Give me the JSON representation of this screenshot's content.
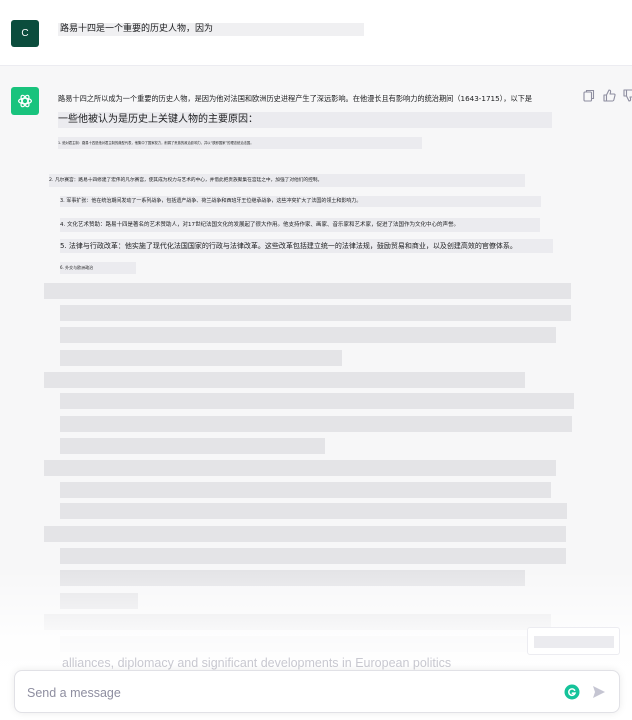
{
  "user": {
    "avatar_letter": "C",
    "prompt": "路易十四是一个重要的历史人物，因为"
  },
  "assistant": {
    "p1": "路易十四之所以成为一个重要的历史人物，是因为他对法国和欧洲历史进程产生了深远影响。在他漫长且有影响力的统治期间（1643-1715），以下是",
    "p2": "一些他被认为是历史上关键人物的主要原因：",
    "l1": "1. 绝对君主制：路易十四是绝对君主制的典型代表，他集中了国家权力，削弱了贵族的政治影响力，并以“朕即国家”的理念统治法国。",
    "l2": "2. 凡尔赛宫：路易十四修建了宏伟的凡尔赛宫，使其成为权力与艺术的中心，并借此把贵族聚集在宫廷之中，加强了对他们的控制。",
    "l3": "3. 军事扩张：他在统治期间发动了一系列战争，包括遗产战争、荷兰战争和西班牙王位继承战争，这些冲突扩大了法国的领土和影响力。",
    "l4": "4. 文化艺术赞助：路易十四是著名的艺术赞助人，对17世纪法国文化的发展起了很大作用。他支持作家、画家、音乐家和艺术家，促进了法国作为文化中心的声誉。",
    "l5": "5. 法律与行政改革：他实施了现代化法国国家的行政与法律改革。这些改革包括建立统一的法律法规，鼓励贸易和商业，以及创建高效的官僚体系。",
    "l6": "6. 外交与欧洲政治"
  },
  "bleed_text": "alliances, diplomacy and significant developments in European politics",
  "composer": {
    "placeholder": "Send a message"
  },
  "colors": {
    "user_avatar": "#0b4d3d",
    "gpt_avatar": "#19c37d",
    "assistant_bg": "#f7f7f8",
    "grammarly": "#15c39a"
  },
  "icons": [
    "copy-icon",
    "thumbs-up-icon",
    "thumbs-down-icon",
    "openai-logo-icon",
    "grammarly-icon",
    "send-icon"
  ]
}
